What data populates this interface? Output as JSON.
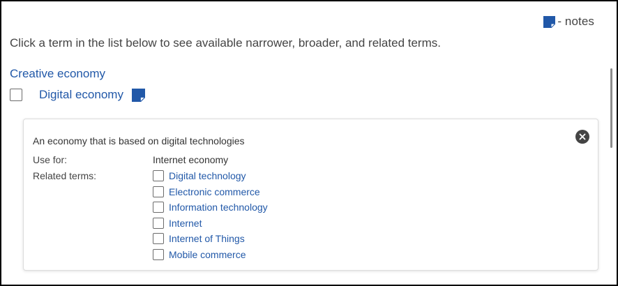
{
  "legend": {
    "icon": "note-icon",
    "label": "- notes"
  },
  "instructions": "Click a term in the list below to see available narrower, broader, and related terms.",
  "broader_term": "Creative economy",
  "selected_term": {
    "label": "Digital economy",
    "checked": false,
    "has_note": true
  },
  "detail": {
    "scope_note": "An economy that is based on digital technologies",
    "use_for_label": "Use for:",
    "use_for_value": "Internet economy",
    "related_label": "Related terms:",
    "related_terms": [
      "Digital technology",
      "Electronic commerce",
      "Information technology",
      "Internet",
      "Internet of Things",
      "Mobile commerce"
    ]
  },
  "colors": {
    "link": "#2158a8",
    "note_icon": "#2158a8",
    "text": "#444444"
  }
}
